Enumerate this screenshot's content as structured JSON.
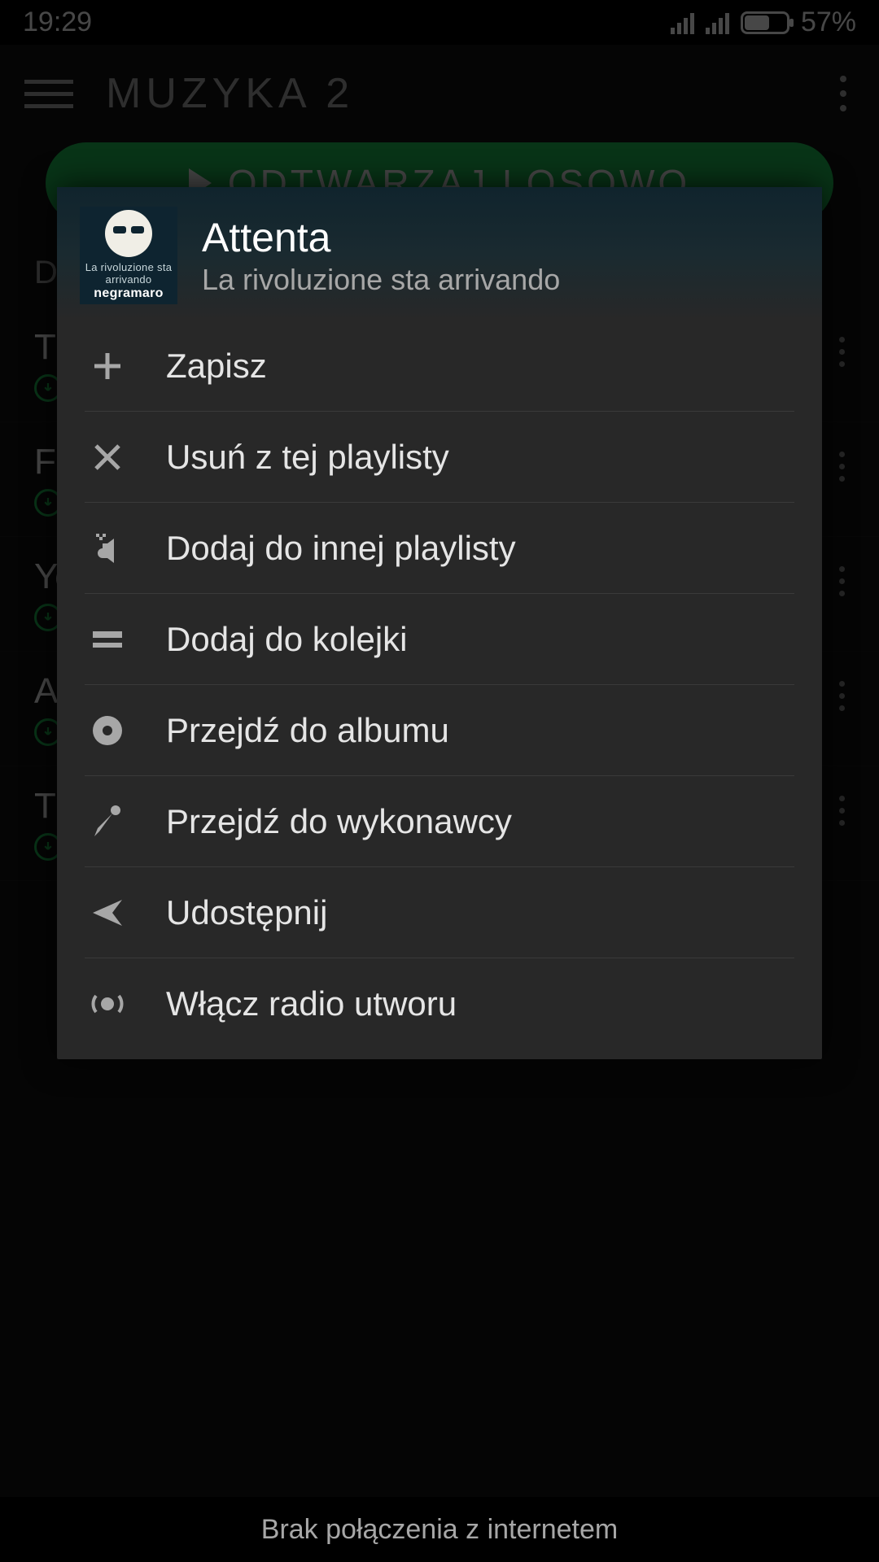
{
  "status": {
    "time": "19:29",
    "battery_pct": "57%"
  },
  "header": {
    "title": "MUZYKA 2"
  },
  "shuffle_label": "ODTWARZAJ LOSOWO",
  "section_label": "Do",
  "tracks": [
    {
      "title": "Th"
    },
    {
      "title": "Fo"
    },
    {
      "title": "Yo"
    },
    {
      "title": "At"
    },
    {
      "title": "Th"
    }
  ],
  "dialog": {
    "song_title": "Attenta",
    "song_subtitle": "La rivoluzione sta arrivando",
    "album_line1": "La rivoluzione sta arrivando",
    "album_line2": "negramaro",
    "menu": [
      {
        "icon": "plus",
        "label": "Zapisz"
      },
      {
        "icon": "x",
        "label": "Usuń z tej playlisty"
      },
      {
        "icon": "addlist",
        "label": "Dodaj do innej playlisty"
      },
      {
        "icon": "queue",
        "label": "Dodaj do kolejki"
      },
      {
        "icon": "album",
        "label": "Przejdź do albumu"
      },
      {
        "icon": "artist",
        "label": "Przejdź do wykonawcy"
      },
      {
        "icon": "share",
        "label": "Udostępnij"
      },
      {
        "icon": "radio",
        "label": "Włącz radio utworu"
      }
    ]
  },
  "footer": "Brak połączenia z internetem"
}
